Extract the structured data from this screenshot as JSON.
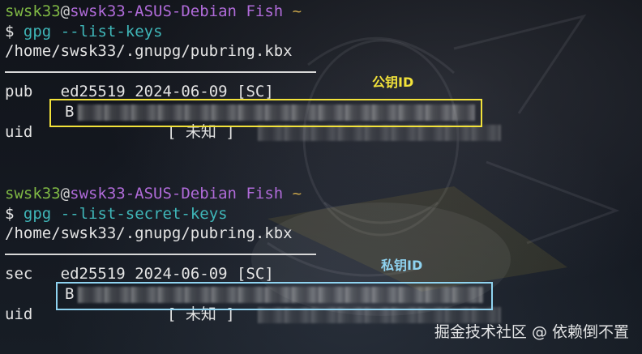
{
  "block1": {
    "prompt_user": "swsk33",
    "prompt_at": "@",
    "prompt_host": "swsk33-ASUS-Debian",
    "prompt_shell": "Fish",
    "prompt_tilde": "~",
    "prompt_symbol": "$",
    "command": "gpg",
    "command_args": "--list-keys",
    "keyring_path": "/home/swsk33/.gnupg/pubring.kbx",
    "key_type_label": "pub",
    "key_algo": "ed25519",
    "key_date": "2024-06-09",
    "key_flags": "[SC]",
    "key_id_prefix": "B",
    "uid_label": "uid",
    "uid_value": "[ 未知 ]",
    "annotation": "公钥ID",
    "annotation_color": "#f2e23a"
  },
  "block2": {
    "prompt_user": "swsk33",
    "prompt_at": "@",
    "prompt_host": "swsk33-ASUS-Debian",
    "prompt_shell": "Fish",
    "prompt_tilde": "~",
    "prompt_symbol": "$",
    "command": "gpg",
    "command_args": "--list-secret-keys",
    "keyring_path": "/home/swsk33/.gnupg/pubring.kbx",
    "key_type_label": "sec",
    "key_algo": "ed25519",
    "key_date": "2024-06-09",
    "key_flags": "[SC]",
    "key_id_prefix": "B",
    "uid_label": "uid",
    "uid_value": "[ 未知 ]",
    "annotation": "私钥ID",
    "annotation_color": "#8fd3f0"
  },
  "watermark": "掘金技术社区 @ 依赖倒不置"
}
